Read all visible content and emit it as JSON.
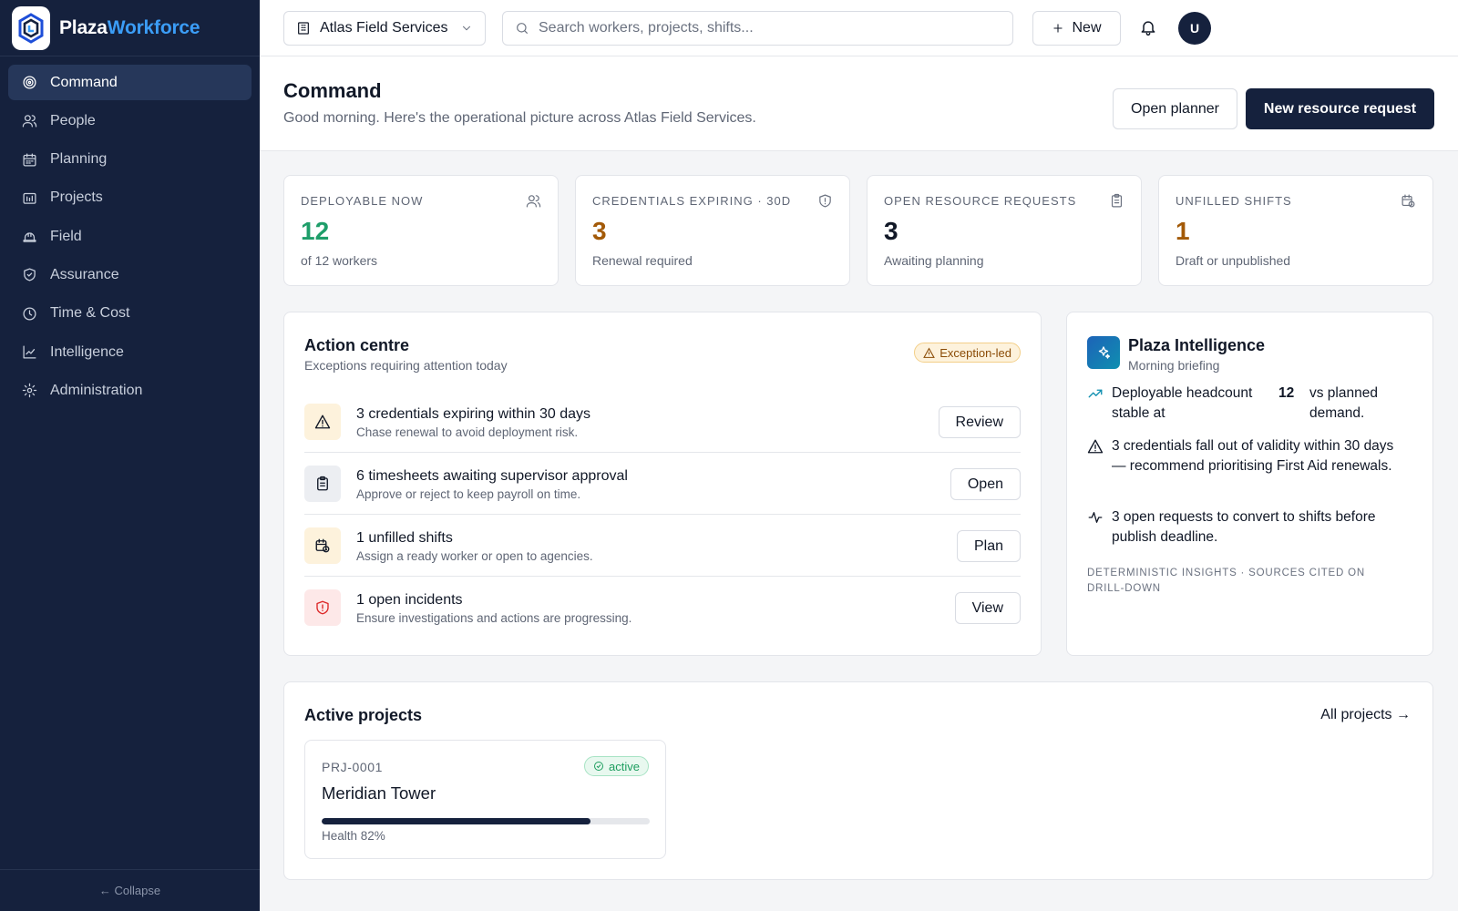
{
  "brand": {
    "name_a": "Plaza",
    "name_b": "Workforce"
  },
  "sidebar": {
    "items": [
      {
        "label": "Command",
        "icon": "target-icon",
        "active": true
      },
      {
        "label": "People",
        "icon": "users-icon"
      },
      {
        "label": "Planning",
        "icon": "calendar-icon"
      },
      {
        "label": "Projects",
        "icon": "folder-icon"
      },
      {
        "label": "Field",
        "icon": "hardhat-icon"
      },
      {
        "label": "Assurance",
        "icon": "shield-icon"
      },
      {
        "label": "Time & Cost",
        "icon": "clock-icon"
      },
      {
        "label": "Intelligence",
        "icon": "chart-icon"
      },
      {
        "label": "Administration",
        "icon": "gear-icon"
      }
    ],
    "collapse_label": "← Collapse"
  },
  "topbar": {
    "org": "Atlas Field Services",
    "search_placeholder": "Search workers, projects, shifts...",
    "new_label": "New",
    "avatar_initial": "U"
  },
  "header": {
    "title": "Command",
    "subtitle": "Good morning. Here's the operational picture across Atlas Field Services.",
    "open_planner": "Open planner",
    "new_request": "New resource request"
  },
  "kpis": [
    {
      "label": "DEPLOYABLE NOW",
      "value": "12",
      "note": "of 12 workers",
      "color": "#1f9e6a",
      "icon": "users-icon"
    },
    {
      "label": "CREDENTIALS EXPIRING · 30D",
      "value": "3",
      "note": "Renewal required",
      "color": "#a35a08",
      "icon": "shield-icon"
    },
    {
      "label": "OPEN RESOURCE REQUESTS",
      "value": "3",
      "note": "Awaiting planning",
      "color": "#111827",
      "icon": "clipboard-icon"
    },
    {
      "label": "UNFILLED SHIFTS",
      "value": "1",
      "note": "Draft or unpublished",
      "color": "#a35a08",
      "icon": "calendar-clock-icon"
    }
  ],
  "action_centre": {
    "title": "Action centre",
    "subtitle": "Exceptions requiring attention today",
    "badge": "Exception-led",
    "items": [
      {
        "title": "3 credentials expiring within 30 days",
        "desc": "Chase renewal to avoid deployment risk.",
        "button": "Review",
        "icon": "warning-icon",
        "tone": "amber"
      },
      {
        "title": "6 timesheets awaiting supervisor approval",
        "desc": "Approve or reject to keep payroll on time.",
        "button": "Open",
        "icon": "clipboard-icon",
        "tone": "grey"
      },
      {
        "title": "1 unfilled shifts",
        "desc": "Assign a ready worker or open to agencies.",
        "button": "Plan",
        "icon": "calendar-clock-icon",
        "tone": "amber"
      },
      {
        "title": "1 open incidents",
        "desc": "Ensure investigations and actions are progressing.",
        "button": "View",
        "icon": "shield-alert-icon",
        "tone": "red"
      }
    ]
  },
  "intelligence": {
    "title": "Plaza Intelligence",
    "subtitle": "Morning briefing",
    "insight_1_a": "Deployable headcount stable at",
    "insight_1_num": "12",
    "insight_1_b": "vs planned demand.",
    "insight_2": "3 credentials fall out of validity within 30 days — recommend prioritising First Aid renewals.",
    "insight_3": "3 open requests to convert to shifts before publish deadline.",
    "footer": "DETERMINISTIC INSIGHTS · SOURCES CITED ON DRILL-DOWN"
  },
  "projects": {
    "title": "Active projects",
    "all_link": "All projects →",
    "items": [
      {
        "code": "PRJ-0001",
        "status": "active",
        "name": "Meridian Tower",
        "health_pct": 82,
        "health_label": "Health 82%"
      }
    ]
  }
}
